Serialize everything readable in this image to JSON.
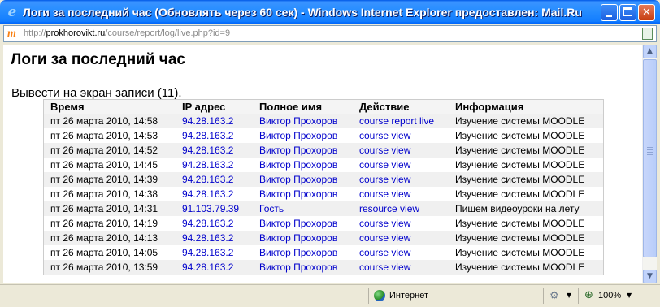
{
  "window": {
    "title": "Логи за последний час (Обновлять через 60 сек) - Windows Internet Explorer предоставлен: Mail.Ru",
    "minimize_glyph": "_",
    "maximize_glyph": "□",
    "close_glyph": "✕"
  },
  "addressbar": {
    "scheme": "http://",
    "host": "prokhorovikt.ru",
    "path": "/course/report/log/live.php?id=9"
  },
  "page": {
    "title": "Логи за последний час",
    "count_text": "Вывести на экран записи (11)."
  },
  "table": {
    "headers": [
      "Время",
      "IP адрес",
      "Полное имя",
      "Действие",
      "Информация"
    ],
    "rows": [
      {
        "time": "пт 26 марта 2010, 14:58",
        "ip": "94.28.163.2",
        "name": "Виктор Прохоров",
        "action": "course report live",
        "info": "Изучение системы MOODLE"
      },
      {
        "time": "пт 26 марта 2010, 14:53",
        "ip": "94.28.163.2",
        "name": "Виктор Прохоров",
        "action": "course view",
        "info": "Изучение системы MOODLE"
      },
      {
        "time": "пт 26 марта 2010, 14:52",
        "ip": "94.28.163.2",
        "name": "Виктор Прохоров",
        "action": "course view",
        "info": "Изучение системы MOODLE"
      },
      {
        "time": "пт 26 марта 2010, 14:45",
        "ip": "94.28.163.2",
        "name": "Виктор Прохоров",
        "action": "course view",
        "info": "Изучение системы MOODLE"
      },
      {
        "time": "пт 26 марта 2010, 14:39",
        "ip": "94.28.163.2",
        "name": "Виктор Прохоров",
        "action": "course view",
        "info": "Изучение системы MOODLE"
      },
      {
        "time": "пт 26 марта 2010, 14:38",
        "ip": "94.28.163.2",
        "name": "Виктор Прохоров",
        "action": "course view",
        "info": "Изучение системы MOODLE"
      },
      {
        "time": "пт 26 марта 2010, 14:31",
        "ip": "91.103.79.39",
        "name": "Гость",
        "action": "resource view",
        "info": "Пишем видеоуроки на лету"
      },
      {
        "time": "пт 26 марта 2010, 14:19",
        "ip": "94.28.163.2",
        "name": "Виктор Прохоров",
        "action": "course view",
        "info": "Изучение системы MOODLE"
      },
      {
        "time": "пт 26 марта 2010, 14:13",
        "ip": "94.28.163.2",
        "name": "Виктор Прохоров",
        "action": "course view",
        "info": "Изучение системы MOODLE"
      },
      {
        "time": "пт 26 марта 2010, 14:05",
        "ip": "94.28.163.2",
        "name": "Виктор Прохоров",
        "action": "course view",
        "info": "Изучение системы MOODLE"
      },
      {
        "time": "пт 26 марта 2010, 13:59",
        "ip": "94.28.163.2",
        "name": "Виктор Прохоров",
        "action": "course view",
        "info": "Изучение системы MOODLE"
      }
    ]
  },
  "statusbar": {
    "zone": "Интернет",
    "zoom": "100%",
    "dropdown_glyph": "▼"
  },
  "icons": {
    "browser": "ie-icon",
    "favicon": "moodle-icon",
    "zone": "globe-icon",
    "protected_mode": "protected-mode-icon",
    "zoom": "zoom-icon"
  },
  "colors": {
    "link": "#0000cc",
    "titlebar": "#2a7fff",
    "row_alt": "#f0f0f0"
  }
}
